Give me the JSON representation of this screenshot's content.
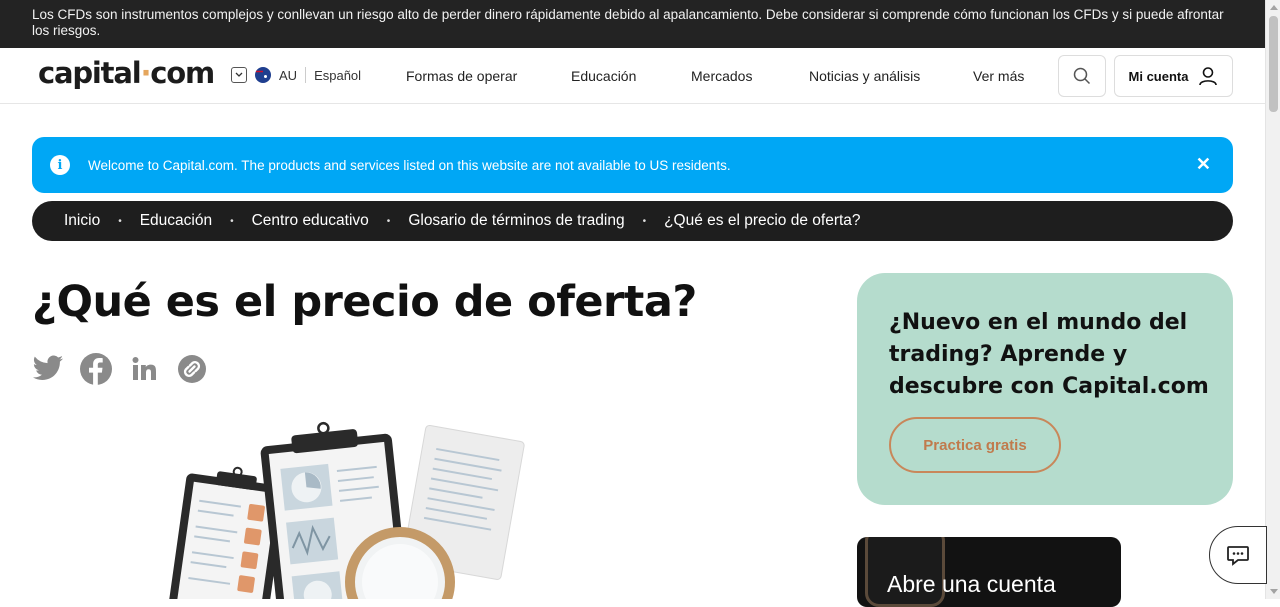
{
  "risk_warning": "Los CFDs son instrumentos complejos y conllevan un riesgo alto de perder dinero rápidamente debido al apalancamiento. Debe considerar si comprende cómo funcionan los CFDs y si puede afrontar los riesgos.",
  "header": {
    "logo_left": "capital",
    "logo_dot": "·",
    "logo_right": "com",
    "region": "AU",
    "language": "Español",
    "nav": [
      "Formas de operar",
      "Educación",
      "Mercados",
      "Noticias y análisis",
      "Ver más"
    ],
    "account_label": "Mi cuenta"
  },
  "notice": {
    "text": "Welcome to Capital.com. The products and services listed on this website are not available to US residents.",
    "close": "✕",
    "info": "i"
  },
  "breadcrumb": [
    "Inicio",
    "Educación",
    "Centro educativo",
    "Glosario de términos de trading",
    "¿Qué es el precio de oferta?"
  ],
  "breadcrumb_sep": "•",
  "page_title": "¿Qué es el precio de oferta?",
  "share_icons": [
    "twitter-icon",
    "facebook-icon",
    "linkedin-icon",
    "copy-link-icon"
  ],
  "promo": {
    "text": "¿Nuevo en el mundo del trading? Aprende y descubre con Capital.com",
    "button": "Practica gratis"
  },
  "open_account_card": {
    "text": "Abre una cuenta"
  },
  "colors": {
    "notice_bg": "#00a7f5",
    "promo_bg": "#b5dccd",
    "accent": "#c8875a",
    "dark": "#1e1e1e"
  }
}
